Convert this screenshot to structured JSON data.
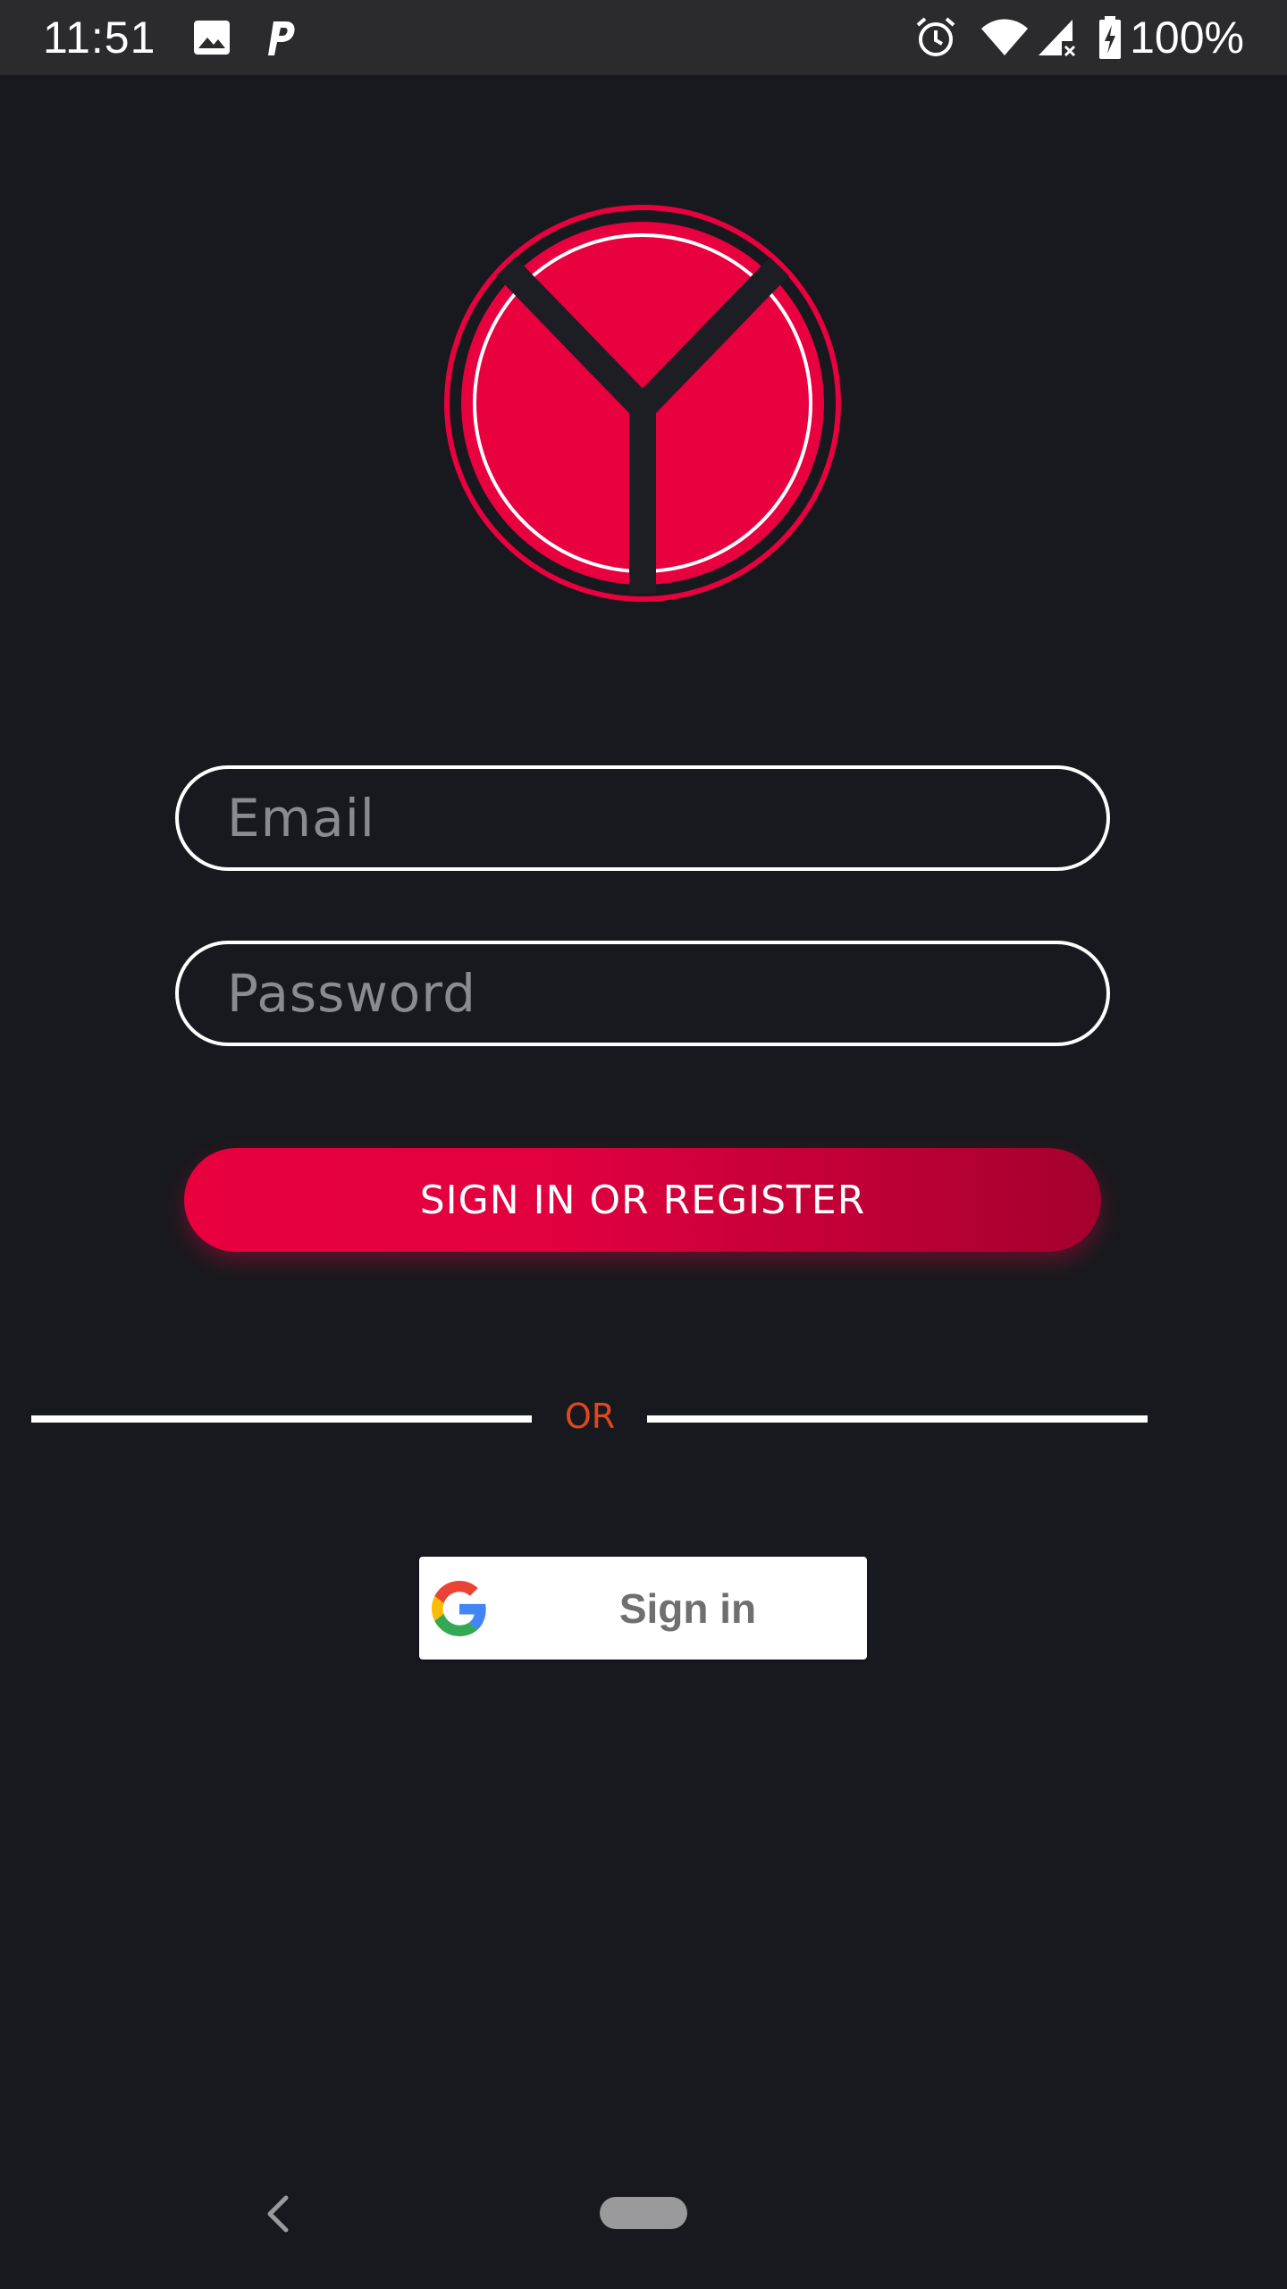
{
  "status_bar": {
    "time": "11:51",
    "battery": "100%",
    "icons": [
      "image-icon",
      "parking-app-icon",
      "alarm-icon",
      "wifi-icon",
      "signal-icon",
      "battery-charging-icon"
    ]
  },
  "logo": {
    "name": "app-logo"
  },
  "form": {
    "email_placeholder": "Email",
    "email_value": "",
    "password_placeholder": "Password",
    "password_value": "",
    "submit_label": "SIGN IN OR REGISTER"
  },
  "divider": {
    "text": "OR"
  },
  "google": {
    "label": "Sign in"
  },
  "colors": {
    "background": "#18191e",
    "accent": "#e8003f",
    "accent_dark": "#a4002e",
    "divider_text": "#e0471b"
  },
  "nav": {
    "icons": [
      "back-icon",
      "home-pill-icon"
    ]
  }
}
